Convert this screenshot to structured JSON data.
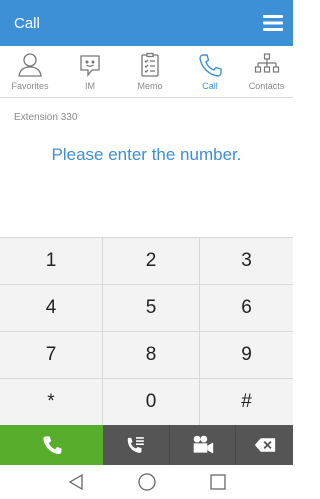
{
  "header": {
    "title": "Call",
    "menu_icon": "hamburger-menu-icon"
  },
  "tabs": [
    {
      "label": "Favorites",
      "icon": "person-icon",
      "active": false
    },
    {
      "label": "IM",
      "icon": "chat-bubble-icon",
      "active": false
    },
    {
      "label": "Memo",
      "icon": "memo-icon",
      "active": false
    },
    {
      "label": "Call",
      "icon": "phone-icon",
      "active": true
    },
    {
      "label": "Contacts",
      "icon": "org-chart-icon",
      "active": false
    }
  ],
  "extension_label": "Extension 330",
  "prompt": "Please enter the number.",
  "keypad": [
    "1",
    "2",
    "3",
    "4",
    "5",
    "6",
    "7",
    "8",
    "9",
    "*",
    "0",
    "#"
  ],
  "actions": {
    "call_icon": "phone-icon",
    "history_icon": "call-history-icon",
    "video_icon": "video-camera-icon",
    "delete_icon": "backspace-icon"
  },
  "colors": {
    "accent": "#3d8fd6",
    "call_green": "#58ad2c",
    "action_gray": "#555555"
  }
}
